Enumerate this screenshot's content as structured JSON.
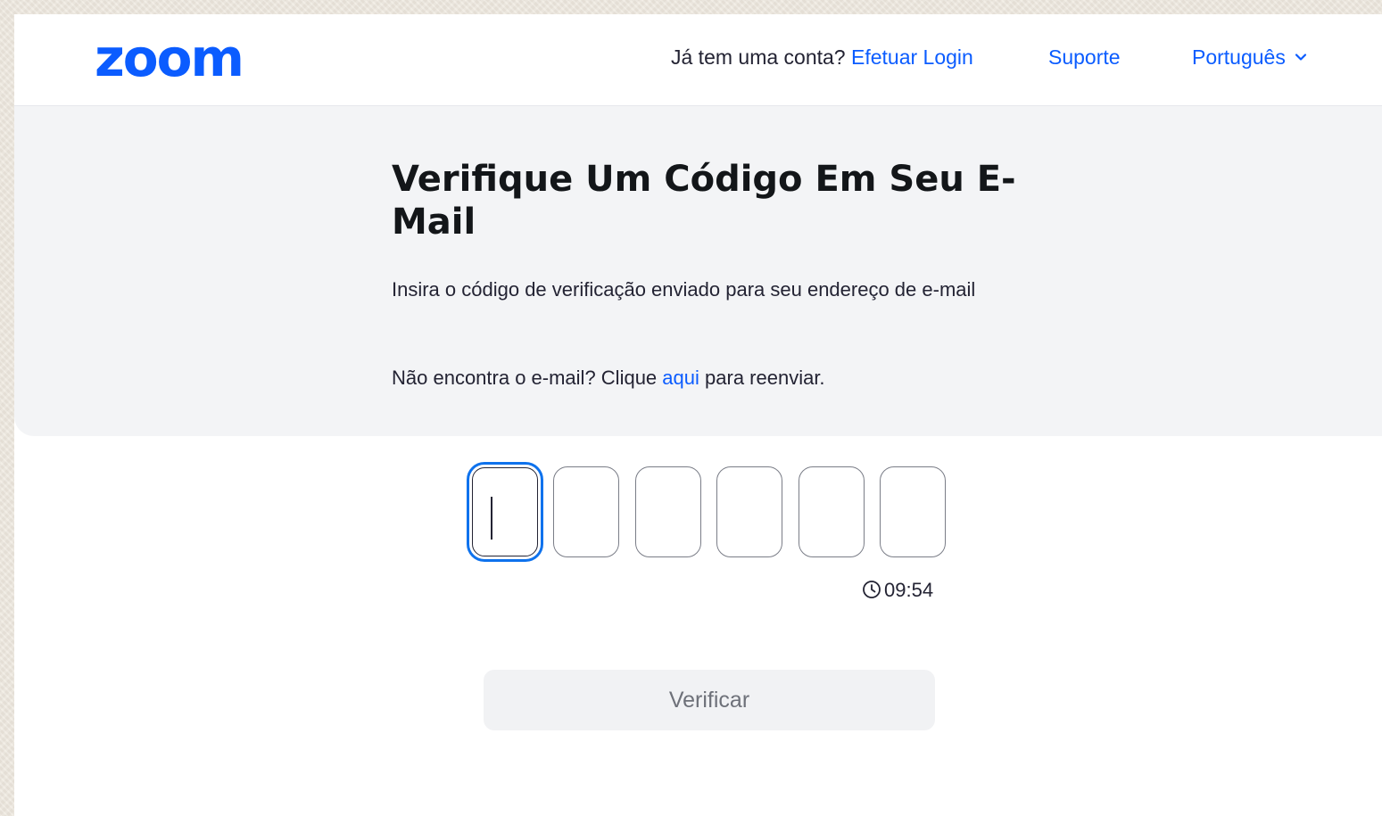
{
  "header": {
    "logo": "zoom",
    "account_prompt": "Já tem uma conta?",
    "login_link": "Efetuar Login",
    "support_link": "Suporte",
    "language": "Português"
  },
  "verification": {
    "title": "Verifique Um Código Em Seu E-Mail",
    "instructions": "Insira o código de verificação enviado para seu endereço de e-mail",
    "resend_prefix": "Não encontra o e-mail? Clique",
    "resend_link": "aqui",
    "resend_suffix": "para reenviar.",
    "code_length": 6,
    "code_values": [
      "",
      "",
      "",
      "",
      "",
      ""
    ],
    "timer": "09:54",
    "verify_button": "Verificar"
  },
  "colors": {
    "brand": "#0b5cff",
    "focus_ring": "#0e72ed",
    "band_background": "#f3f4f6",
    "button_disabled_background": "#f1f2f4",
    "button_disabled_text": "#6e7179"
  },
  "icons": {
    "language_dropdown": "chevron-down-icon",
    "timer": "clock-icon"
  }
}
